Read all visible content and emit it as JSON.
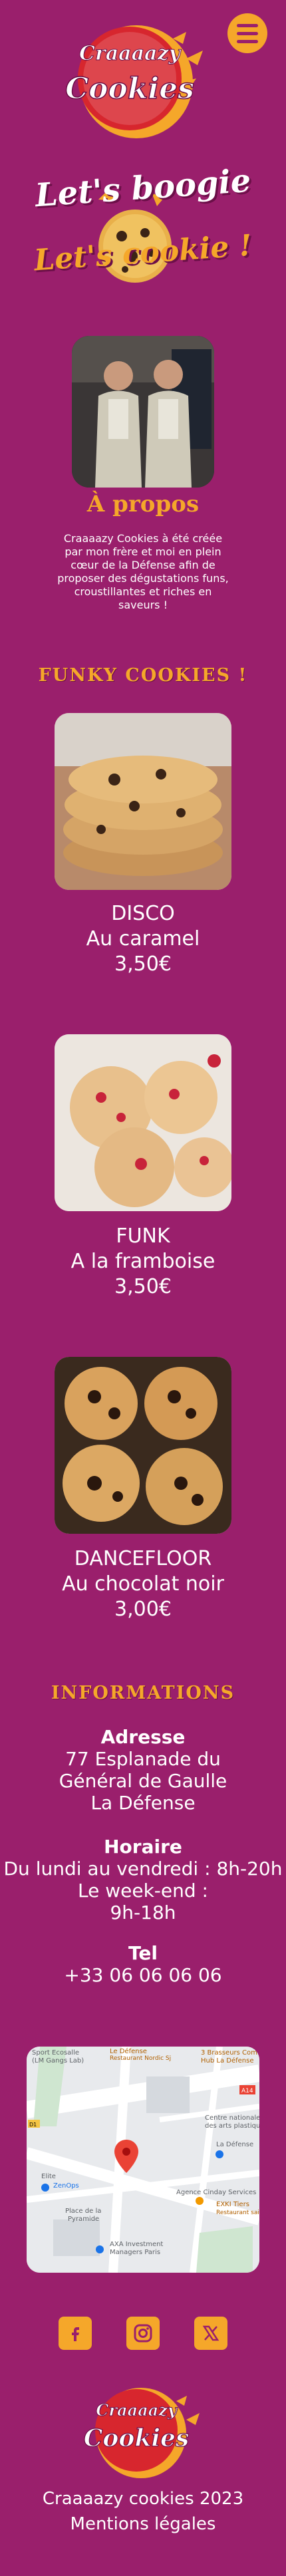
{
  "header": {
    "logo_text_line1": "Craaaazy",
    "logo_text_line2": "Cookies",
    "menu_icon": "hamburger-menu-icon"
  },
  "hero": {
    "line1": "Let's boogie",
    "line2": "Let's cookie !"
  },
  "about": {
    "title": "À propos",
    "text": "Craaaazy Cookies à été créée par mon frère et moi en plein cœur de la Défense afin de proposer des dégustations funs, croustillantes et riches en saveurs !"
  },
  "products": {
    "title": "FUNKY COOKIES !",
    "items": [
      {
        "name": "DISCO",
        "flavor": "Au caramel",
        "price": "3,50€"
      },
      {
        "name": "FUNK",
        "flavor": "A la framboise",
        "price": "3,50€"
      },
      {
        "name": "DANCEFLOOR",
        "flavor": "Au chocolat noir",
        "price": "3,00€"
      }
    ]
  },
  "informations": {
    "title": "INFORMATIONS",
    "address_label": "Adresse",
    "address_lines": [
      "77 Esplanade du",
      "Général de Gaulle",
      "La Défense"
    ],
    "hours_label": "Horaire",
    "hours_lines": [
      "Du lundi au vendredi : 8h-20h",
      "Le week-end :",
      "9h-18h"
    ],
    "tel_label": "Tel",
    "tel": "+33 06 06 06 06"
  },
  "map": {
    "labels": [
      "Sport Ecosalle",
      "(LM Gangs Lab)",
      "Le Défense",
      "Restaurant Nordic Sj",
      "3 Brasseurs Comm",
      "Hub La Défense",
      "Centre nationale",
      "des arts plastiques",
      "La Défense",
      "Elite",
      "ZenOps",
      "Place de la",
      "Pyramide",
      "Agence Cinday Services",
      "EXKI Tiers",
      "Restaurant sains",
      "AXA Investment",
      "Managers Paris",
      "A14",
      "D1"
    ]
  },
  "social": {
    "facebook_icon": "facebook-icon",
    "instagram_icon": "instagram-icon",
    "x_icon": "x-icon"
  },
  "footer": {
    "copyright": "Craaaazy cookies 2023",
    "legal": "Mentions légales"
  },
  "colors": {
    "background": "#9a1f6c",
    "accent": "#f5a72a",
    "text": "#ffffff"
  }
}
